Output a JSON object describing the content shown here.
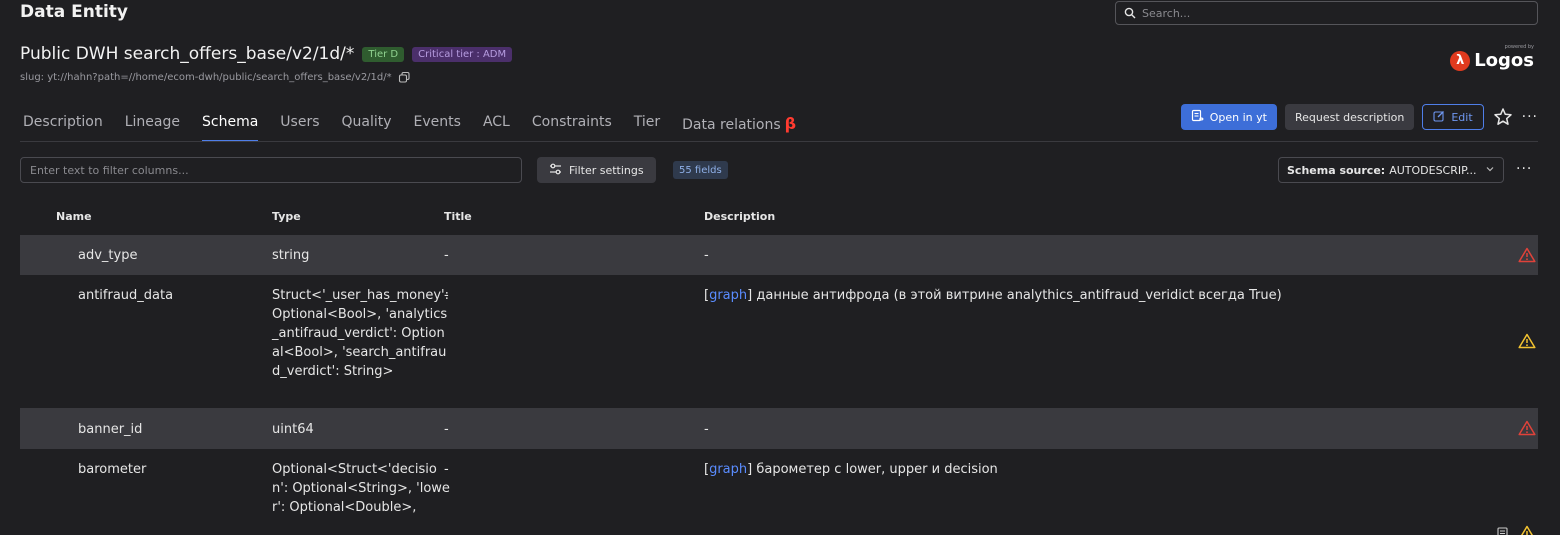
{
  "header": {
    "title": "Data Entity",
    "search_placeholder": "Search..."
  },
  "entity": {
    "name": "Public DWH search_offers_base/v2/1d/*",
    "tier_badge": "Tier D",
    "critical_badge": "Critical tier : ADM",
    "slug": "slug: yt://hahn?path=//home/ecom-dwh/public/search_offers_base/v2/1d/*"
  },
  "logo": {
    "powered": "powered by",
    "word": "Logos"
  },
  "tabs": [
    {
      "label": "Description"
    },
    {
      "label": "Lineage"
    },
    {
      "label": "Schema"
    },
    {
      "label": "Users"
    },
    {
      "label": "Quality"
    },
    {
      "label": "Events"
    },
    {
      "label": "ACL"
    },
    {
      "label": "Constraints"
    },
    {
      "label": "Tier"
    },
    {
      "label": "Data relations",
      "suffix": "β"
    }
  ],
  "active_tab": "Schema",
  "actions": {
    "open_label": "Open in yt",
    "request_label": "Request description",
    "edit_label": "Edit",
    "more": "···"
  },
  "filter": {
    "placeholder": "Enter text to filter columns...",
    "settings_label": "Filter settings",
    "fields_count": "55 fields"
  },
  "schema_source": {
    "label": "Schema source:",
    "value": "AUTODESCRIP..."
  },
  "table": {
    "headers": {
      "name": "Name",
      "type": "Type",
      "title": "Title",
      "description": "Description"
    },
    "rows": [
      {
        "name": "adv_type",
        "type": "string",
        "title": "-",
        "desc_link": "",
        "desc_text": "-",
        "warn": "red"
      },
      {
        "name": "antifraud_data",
        "type": "Struct<'_user_has_money': Optional<Bool>, 'analytics_antifraud_verdict': Optional<Bool>, 'search_antifraud_verdict': String>",
        "title": "-",
        "desc_link": "graph",
        "desc_text": "данные антифрода (в этой витрине analythics_antifraud_veridict всегда True)",
        "warn": "yellow"
      },
      {
        "name": "banner_id",
        "type": "uint64",
        "title": "-",
        "desc_link": "",
        "desc_text": "-",
        "warn": "red"
      },
      {
        "name": "barometer",
        "type": "Optional<Struct<'decision': Optional<String>, 'lower': Optional<Double>,",
        "title": "-",
        "desc_link": "graph",
        "desc_text": "барометер с lower, upper и decision",
        "warn": "yellow"
      }
    ]
  },
  "colors": {
    "accent": "#3d6ed8",
    "warn_red": "#e0423a",
    "warn_yellow": "#f2c230",
    "link": "#5a8cff"
  }
}
